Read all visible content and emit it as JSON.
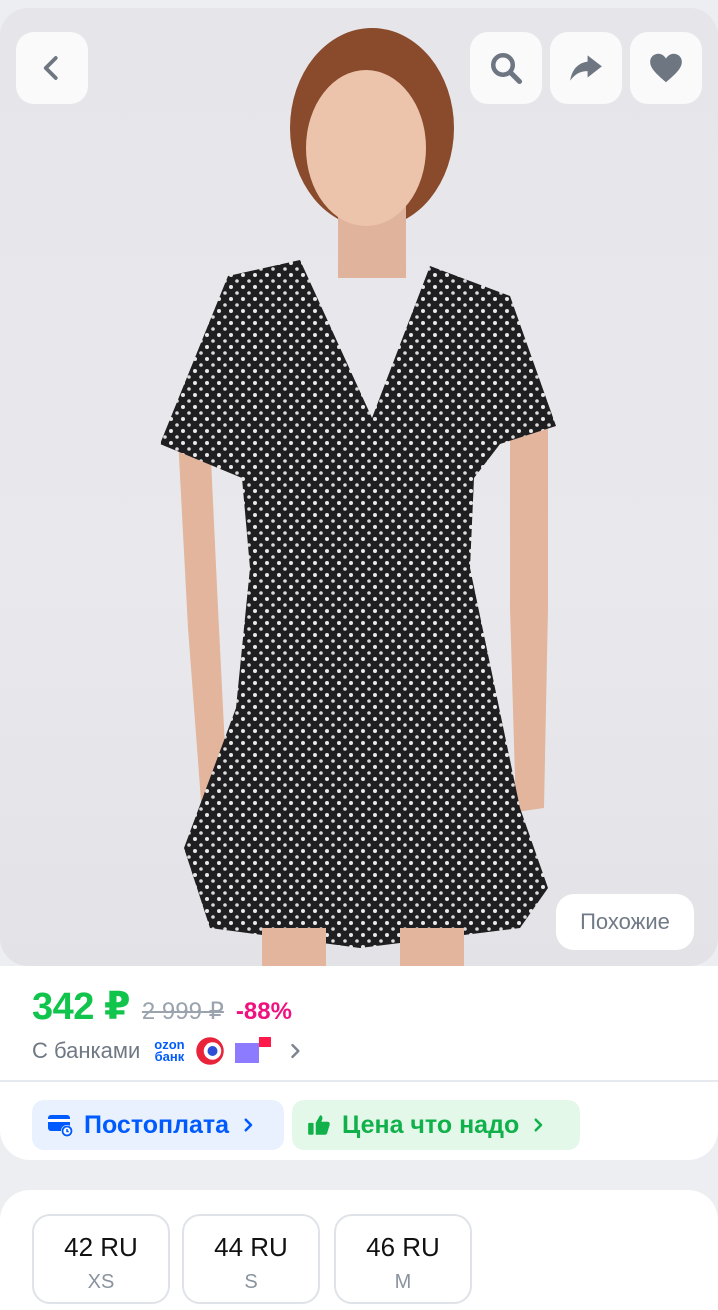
{
  "header": {
    "back_icon": "chevron-left-icon",
    "search_icon": "search-icon",
    "share_icon": "share-arrow-icon",
    "favorite_icon": "heart-icon"
  },
  "gallery": {
    "similar_label": "Похожие"
  },
  "price": {
    "current": "342 ₽",
    "old": "2 999 ₽",
    "discount": "-88%"
  },
  "banks": {
    "label": "С банками",
    "ozon_line1": "ozon",
    "ozon_line2": "банк"
  },
  "badges": {
    "postpay_label": "Постоплата",
    "price_label": "Цена что надо"
  },
  "sizes": [
    {
      "ru": "42 RU",
      "intl": "XS"
    },
    {
      "ru": "44 RU",
      "intl": "S"
    },
    {
      "ru": "46 RU",
      "intl": "M"
    }
  ],
  "colors": {
    "price_green": "#10c44c",
    "discount_pink": "#f1117e",
    "ozon_blue": "#005bff"
  }
}
